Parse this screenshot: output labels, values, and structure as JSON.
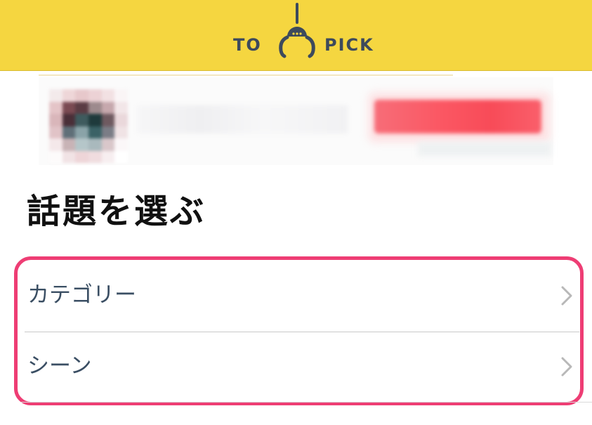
{
  "header": {
    "logo_left": "TO",
    "logo_right": "PICK",
    "logo_icon": "claw-icon",
    "background": "#f5d640"
  },
  "section": {
    "title": "話題を選ぶ"
  },
  "topic_list": {
    "items": [
      {
        "label": "カテゴリー",
        "icon": "chevron-right-icon"
      },
      {
        "label": "シーン",
        "icon": "chevron-right-icon"
      }
    ],
    "highlight_color": "#ee3d74"
  },
  "colors": {
    "text": "#3a4e63",
    "title": "#111111",
    "chevron": "#b8b8b8"
  }
}
